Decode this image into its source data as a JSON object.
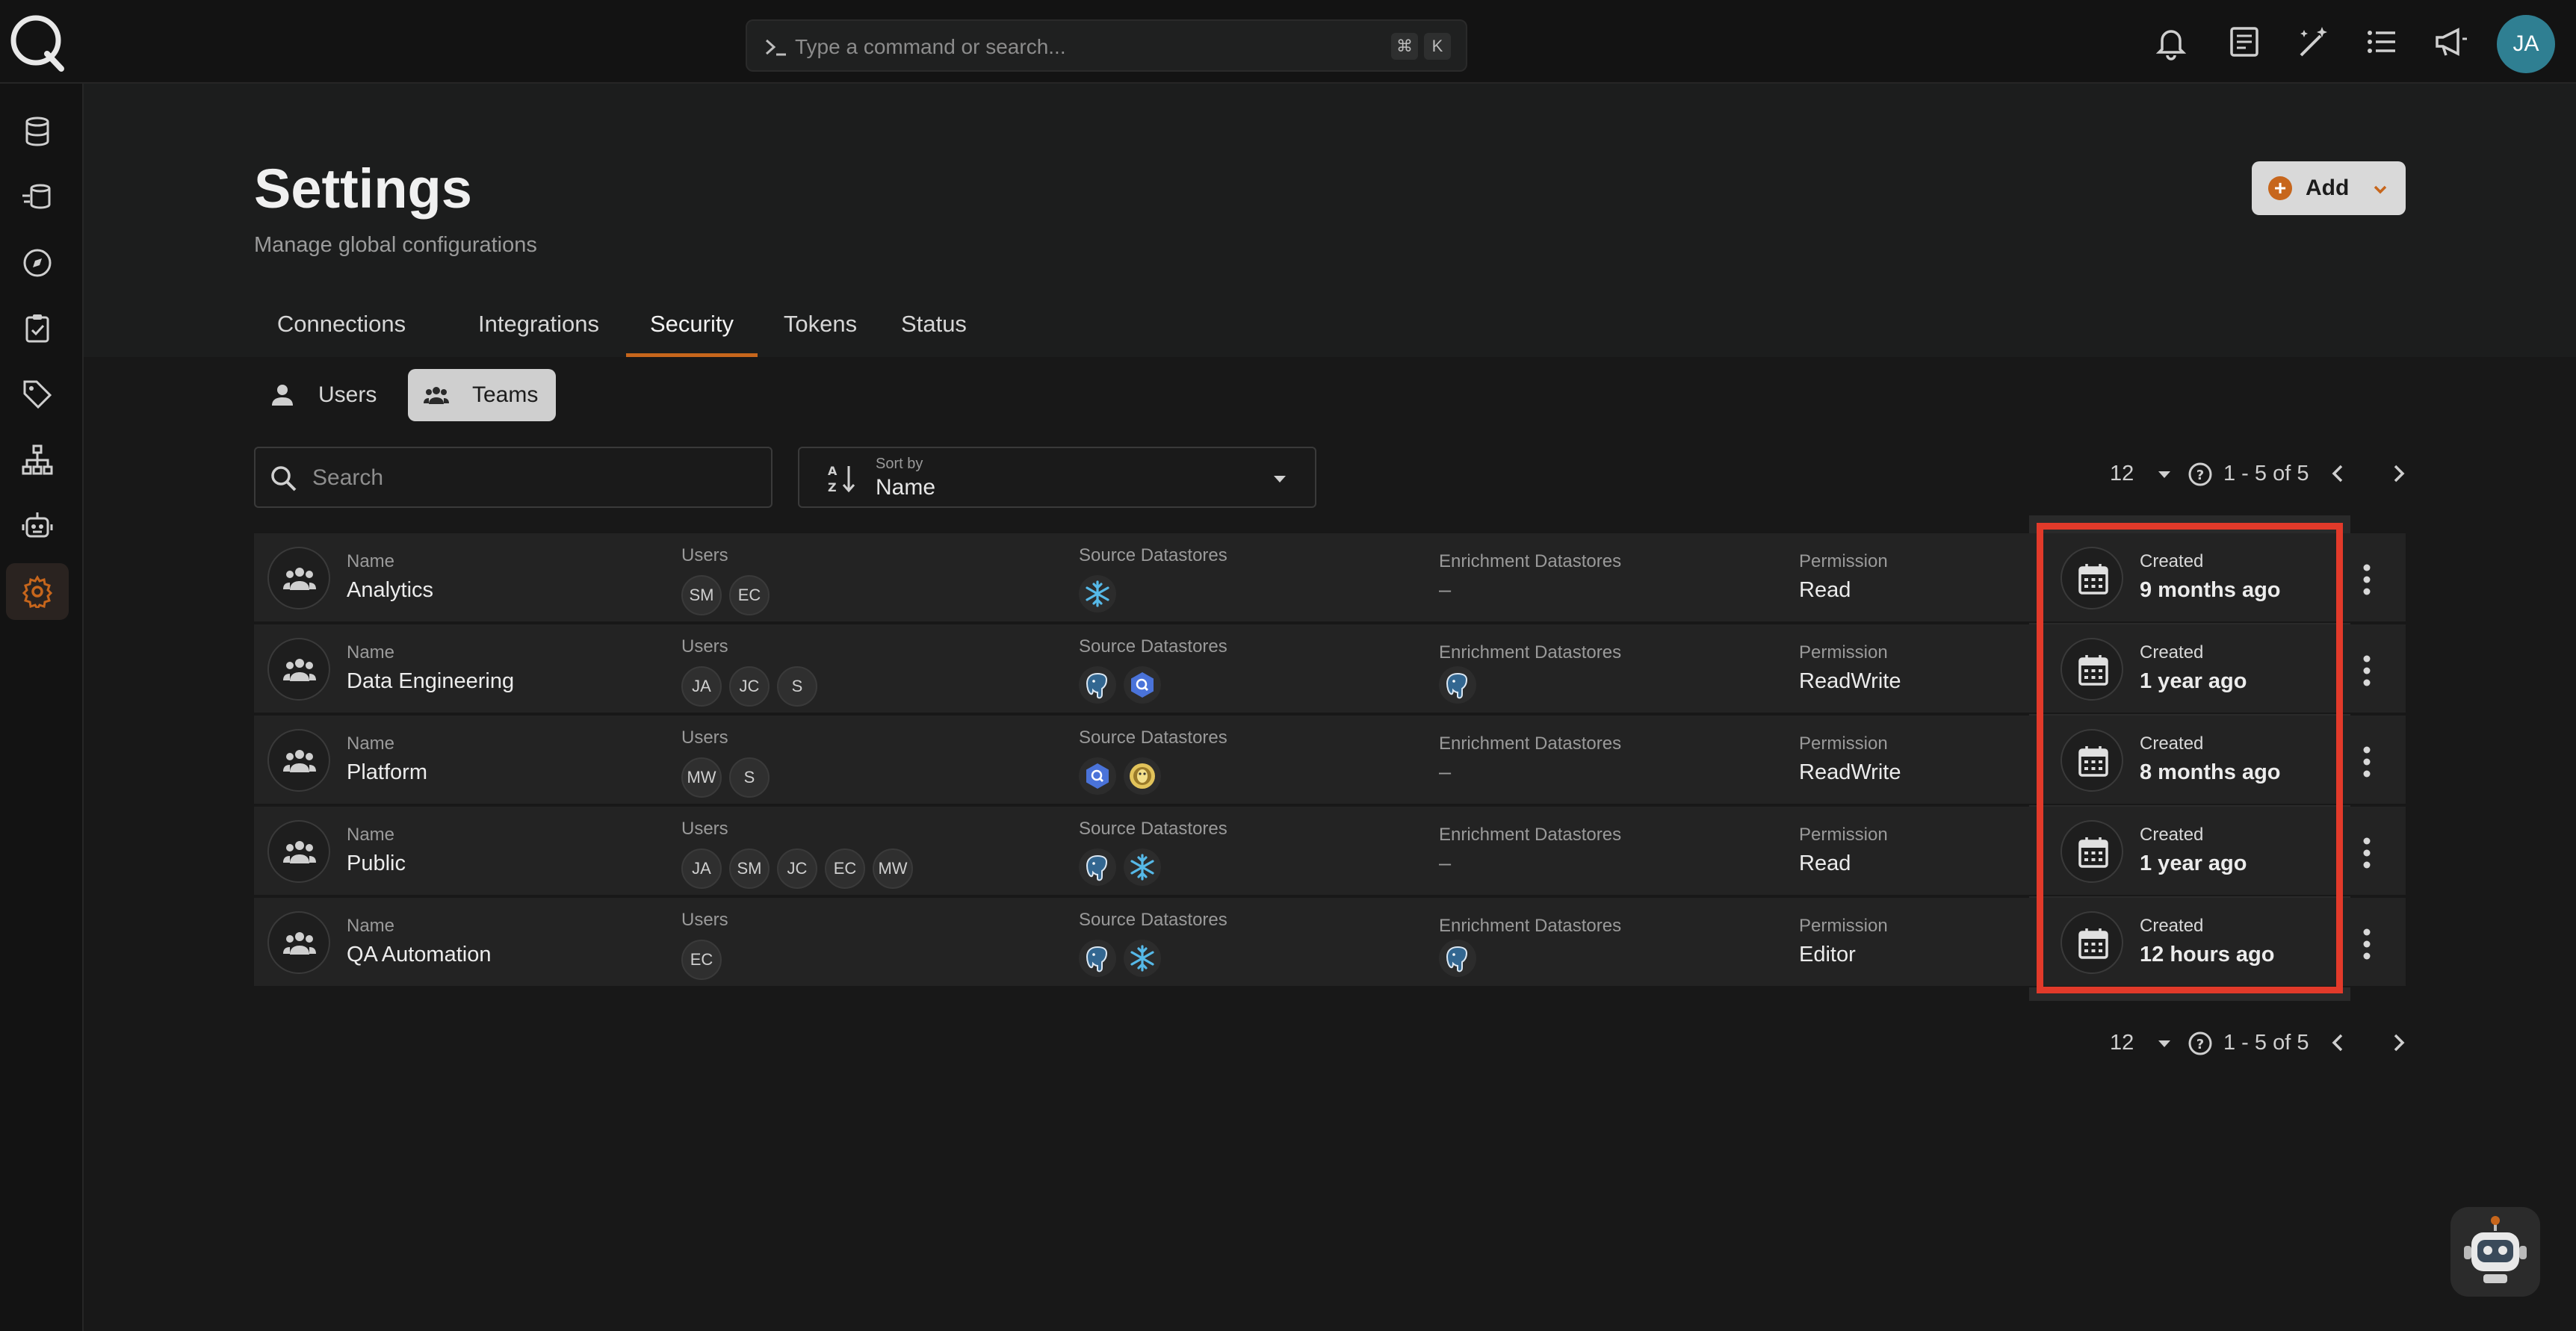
{
  "topbar": {
    "command_placeholder": "Type a command or search...",
    "shortcut_keys": [
      "⌘",
      "K"
    ],
    "avatar_initials": "JA",
    "icons": [
      "bell-icon",
      "document-icon",
      "wand-icon",
      "list-icon",
      "megaphone-icon"
    ]
  },
  "sidebar": {
    "items": [
      {
        "icon": "database-icon"
      },
      {
        "icon": "datastore-stack-icon"
      },
      {
        "icon": "compass-icon"
      },
      {
        "icon": "clipboard-check-icon"
      },
      {
        "icon": "tag-icon"
      },
      {
        "icon": "hierarchy-icon"
      },
      {
        "icon": "robot-icon"
      },
      {
        "icon": "gear-icon",
        "active": true
      }
    ]
  },
  "header": {
    "title": "Settings",
    "subtitle": "Manage global configurations",
    "add_label": "Add"
  },
  "tabs": [
    {
      "label": "Connections"
    },
    {
      "label": "Integrations"
    },
    {
      "label": "Security",
      "active": true
    },
    {
      "label": "Tokens"
    },
    {
      "label": "Status"
    }
  ],
  "segments": [
    {
      "label": "Users"
    },
    {
      "label": "Teams",
      "active": true
    }
  ],
  "search": {
    "placeholder": "Search"
  },
  "sort": {
    "caption": "Sort by",
    "value": "Name"
  },
  "pagination": {
    "per_page": "12",
    "range": "1 - 5 of 5"
  },
  "columns": {
    "name": "Name",
    "users": "Users",
    "source": "Source Datastores",
    "enrichment": "Enrichment Datastores",
    "permission": "Permission",
    "created": "Created"
  },
  "teams": [
    {
      "name": "Analytics",
      "users": [
        "SM",
        "EC"
      ],
      "source": [
        "snowflake"
      ],
      "enrichment": "–",
      "enrichment_icons": [],
      "permission": "Read",
      "created": "9 months ago"
    },
    {
      "name": "Data Engineering",
      "users": [
        "JA",
        "JC",
        "S"
      ],
      "source": [
        "postgres",
        "bigquery"
      ],
      "enrichment": "",
      "enrichment_icons": [
        "postgres"
      ],
      "permission": "ReadWrite",
      "created": "1 year ago"
    },
    {
      "name": "Platform",
      "users": [
        "MW",
        "S"
      ],
      "source": [
        "bigquery",
        "hive"
      ],
      "enrichment": "–",
      "enrichment_icons": [],
      "permission": "ReadWrite",
      "created": "8 months ago"
    },
    {
      "name": "Public",
      "users": [
        "JA",
        "SM",
        "JC",
        "EC",
        "MW"
      ],
      "source": [
        "postgres",
        "snowflake"
      ],
      "enrichment": "–",
      "enrichment_icons": [],
      "permission": "Read",
      "created": "1 year ago"
    },
    {
      "name": "QA Automation",
      "users": [
        "EC"
      ],
      "source": [
        "postgres",
        "snowflake"
      ],
      "enrichment": "",
      "enrichment_icons": [
        "postgres"
      ],
      "permission": "Editor",
      "created": "12 hours ago"
    }
  ],
  "colors": {
    "accent": "#c7661c",
    "highlight": "#e23a2a",
    "avatar": "#2f7f92"
  }
}
